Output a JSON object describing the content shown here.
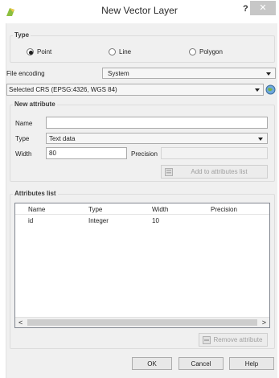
{
  "window": {
    "title": "New Vector Layer",
    "help_glyph": "?",
    "close_glyph": "✕"
  },
  "type_group": {
    "title": "Type",
    "options": [
      {
        "label": "Point",
        "selected": true
      },
      {
        "label": "Line",
        "selected": false
      },
      {
        "label": "Polygon",
        "selected": false
      }
    ]
  },
  "file_encoding": {
    "label": "File encoding",
    "value": "System"
  },
  "crs": {
    "value": "Selected CRS (EPSG:4326, WGS 84)"
  },
  "new_attribute": {
    "title": "New attribute",
    "name_label": "Name",
    "name_value": "",
    "type_label": "Type",
    "type_value": "Text data",
    "width_label": "Width",
    "width_value": "80",
    "precision_label": "Precision",
    "precision_value": "",
    "add_button": "Add to attributes list"
  },
  "attributes_list": {
    "title": "Attributes list",
    "columns": [
      "Name",
      "Type",
      "Width",
      "Precision"
    ],
    "rows": [
      [
        "id",
        "Integer",
        "10",
        ""
      ]
    ],
    "remove_button": "Remove attribute",
    "scroll_left": "<",
    "scroll_right": ">"
  },
  "footer": {
    "ok": "OK",
    "cancel": "Cancel",
    "help": "Help"
  }
}
